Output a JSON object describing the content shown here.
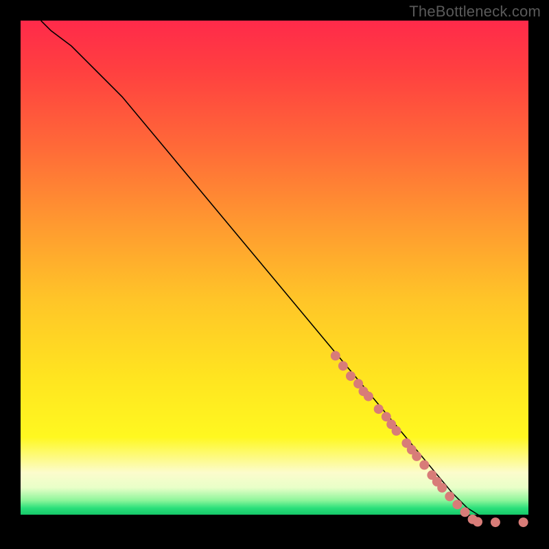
{
  "watermark": "TheBottleneck.com",
  "chart_data": {
    "type": "line",
    "title": "",
    "xlabel": "",
    "ylabel": "",
    "xlim": [
      0,
      100
    ],
    "ylim": [
      0,
      100
    ],
    "grid": false,
    "legend": false,
    "series": [
      {
        "name": "curve",
        "x": [
          4,
          6,
          10,
          15,
          20,
          30,
          40,
          50,
          60,
          70,
          80,
          85,
          88,
          92,
          96,
          100
        ],
        "y": [
          100,
          98,
          95,
          90,
          85,
          73,
          61,
          49,
          37,
          25,
          13,
          7,
          4,
          1.5,
          1.2,
          1.2
        ]
      }
    ],
    "scatter": [
      {
        "name": "dots",
        "color": "#d87c78",
        "points": [
          {
            "x": 62,
            "y": 34
          },
          {
            "x": 63.5,
            "y": 32
          },
          {
            "x": 65,
            "y": 30
          },
          {
            "x": 66.5,
            "y": 28.5
          },
          {
            "x": 67.5,
            "y": 27
          },
          {
            "x": 68.5,
            "y": 26
          },
          {
            "x": 70.5,
            "y": 23.5
          },
          {
            "x": 72,
            "y": 22
          },
          {
            "x": 73,
            "y": 20.5
          },
          {
            "x": 74,
            "y": 19.2
          },
          {
            "x": 76,
            "y": 16.8
          },
          {
            "x": 77,
            "y": 15.5
          },
          {
            "x": 78,
            "y": 14.2
          },
          {
            "x": 79.5,
            "y": 12.5
          },
          {
            "x": 81,
            "y": 10.5
          },
          {
            "x": 82,
            "y": 9.2
          },
          {
            "x": 83,
            "y": 8
          },
          {
            "x": 84.5,
            "y": 6.3
          },
          {
            "x": 86,
            "y": 4.7
          },
          {
            "x": 87.5,
            "y": 3.2
          },
          {
            "x": 89,
            "y": 1.8
          },
          {
            "x": 90,
            "y": 1.3
          },
          {
            "x": 93.5,
            "y": 1.2
          },
          {
            "x": 99,
            "y": 1.2
          }
        ]
      }
    ],
    "background_gradient": {
      "stops": [
        {
          "pos": 0.0,
          "color": "#ff2a4a"
        },
        {
          "pos": 0.55,
          "color": "#ffc528"
        },
        {
          "pos": 0.82,
          "color": "#fff820"
        },
        {
          "pos": 0.96,
          "color": "#2adf7a"
        },
        {
          "pos": 0.973,
          "color": "#16c96a"
        },
        {
          "pos": 1.0,
          "color": "#000000"
        }
      ]
    }
  }
}
